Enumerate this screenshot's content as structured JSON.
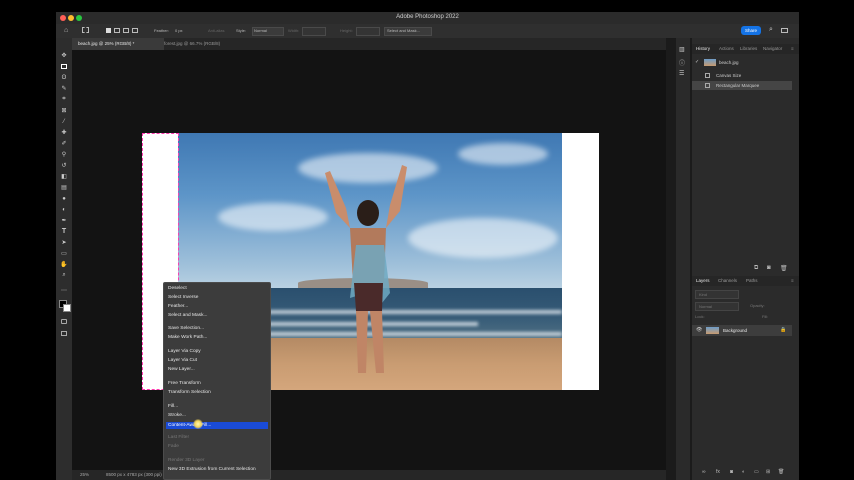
{
  "app": {
    "title": "Adobe Photoshop 2022"
  },
  "options_bar": {
    "feather_label": "Feather:",
    "feather_value": "0 px",
    "antialias_label": "Anti-alias",
    "style_label": "Style:",
    "style_value": "Normal",
    "width_label": "Width:",
    "height_label": "Height:",
    "select_mask_label": "Select and Mask...",
    "share_label": "Share"
  },
  "tabs": [
    {
      "label": "beach.jpg @ 25% (RGB/8) *"
    },
    {
      "label": "forest.jpg @ 66.7% (RGB/8)"
    }
  ],
  "status": {
    "zoom": "25%",
    "doc_info": "8500 px x 4783 px (300 ppi)"
  },
  "history_panel": {
    "tabs": [
      "History",
      "Actions",
      "Libraries",
      "Navigator"
    ],
    "snapshot": "beach.jpg",
    "items": [
      "Canvas Size",
      "Rectangular Marquee"
    ]
  },
  "layers_panel": {
    "tabs": [
      "Layers",
      "Channels",
      "Paths"
    ],
    "kind_label": "Kind",
    "blend_mode": "Normal",
    "opacity_label": "Opacity:",
    "lock_label": "Lock:",
    "fill_label": "Fill:",
    "layer_name": "Background"
  },
  "context_menu": {
    "items": [
      {
        "label": "Deselect",
        "state": "normal"
      },
      {
        "label": "Select Inverse",
        "state": "normal"
      },
      {
        "label": "Feather...",
        "state": "normal"
      },
      {
        "label": "Select and Mask...",
        "state": "normal"
      },
      {
        "label": "Save Selection...",
        "state": "normal"
      },
      {
        "label": "Make Work Path...",
        "state": "normal"
      },
      {
        "label": "Layer Via Copy",
        "state": "normal"
      },
      {
        "label": "Layer Via Cut",
        "state": "normal"
      },
      {
        "label": "New Layer...",
        "state": "normal"
      },
      {
        "label": "Free Transform",
        "state": "normal"
      },
      {
        "label": "Transform Selection",
        "state": "normal"
      },
      {
        "label": "Fill...",
        "state": "normal"
      },
      {
        "label": "Stroke...",
        "state": "normal"
      },
      {
        "label": "Content-Aware Fill...",
        "state": "selected"
      },
      {
        "label": "Last Filter",
        "state": "disabled"
      },
      {
        "label": "Fade",
        "state": "disabled"
      },
      {
        "label": "Render 3D Layer",
        "state": "disabled"
      },
      {
        "label": "New 3D Extrusion from Current Selection",
        "state": "normal"
      }
    ]
  },
  "colors": {
    "accent": "#1473e6",
    "menu_highlight": "#1a4bd6",
    "marquee": "#ff3ab0"
  }
}
